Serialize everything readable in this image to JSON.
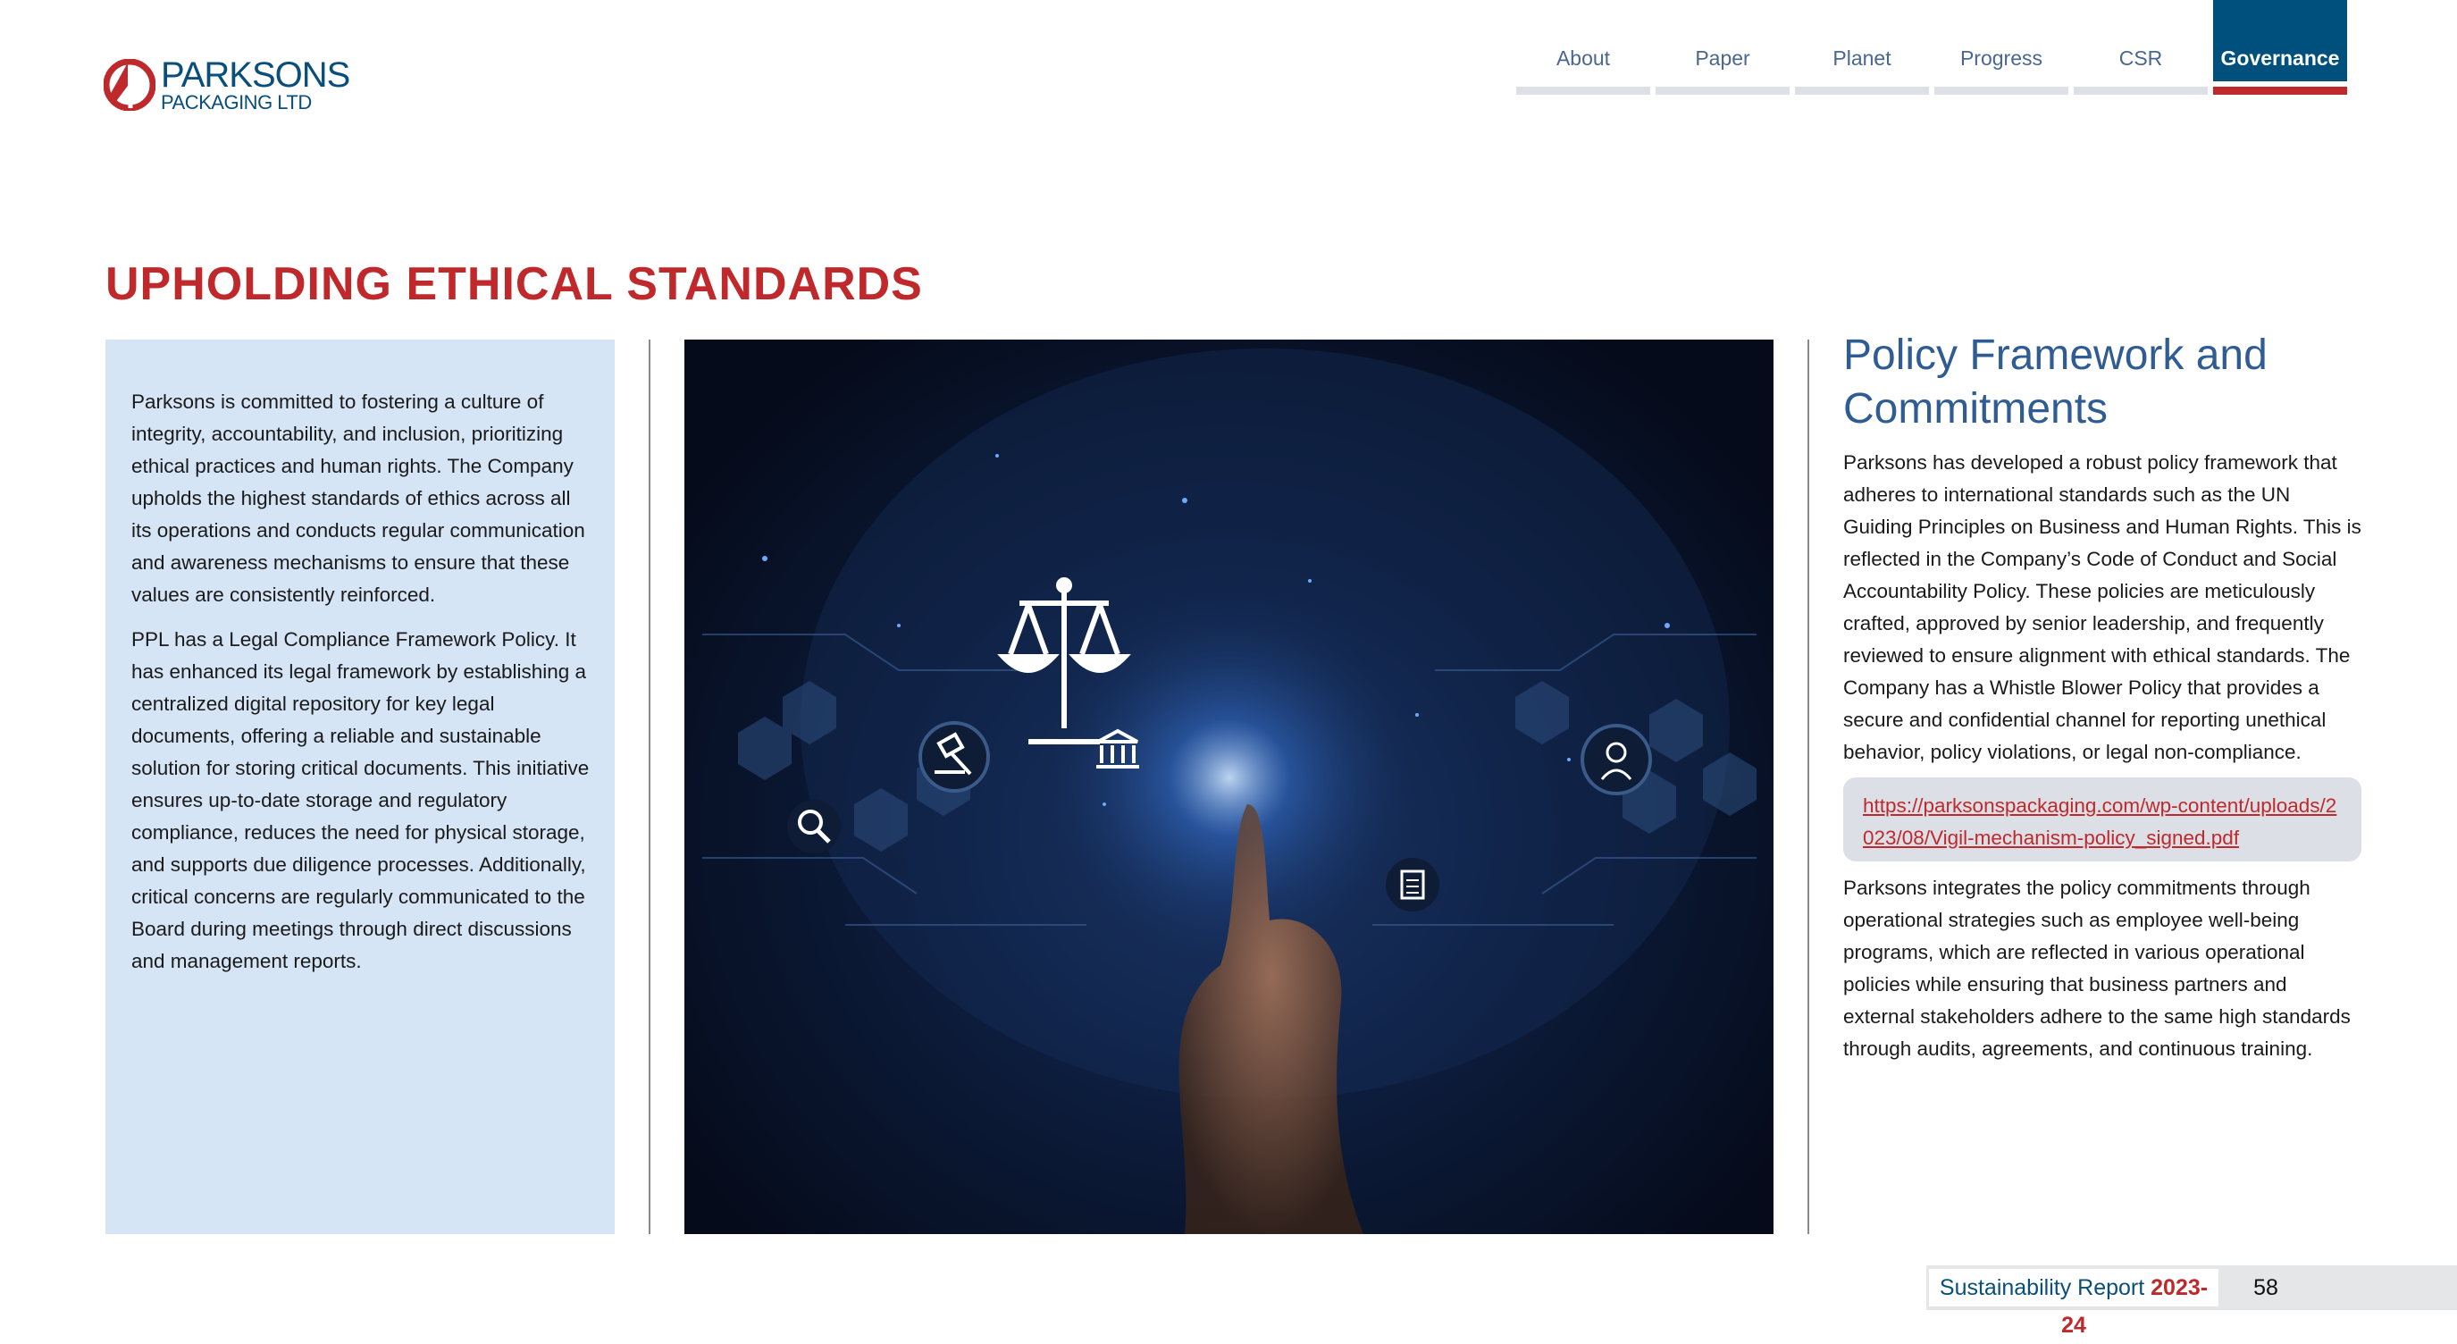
{
  "logo": {
    "line1": "PARKSONS",
    "line2": "PACKAGING LTD",
    "colors": {
      "red": "#c0292b",
      "blue": "#0a4e7c"
    }
  },
  "nav": {
    "tabs": [
      {
        "label": "About"
      },
      {
        "label": "Paper"
      },
      {
        "label": "Planet"
      },
      {
        "label": "Progress"
      },
      {
        "label": "CSR"
      },
      {
        "label": "Governance",
        "active": true
      }
    ]
  },
  "page_title": "UPHOLDING ETHICAL STANDARDS",
  "left": {
    "paragraphs": [
      "Parksons is committed to fostering a culture of integrity, accountability, and inclusion, prioritizing ethical practices and human rights. The Company upholds the highest standards of ethics across all its operations and conducts regular communication and awareness mechanisms to ensure that these values are consistently reinforced.",
      "PPL has a Legal Compliance Framework Policy. It has enhanced its legal framework by establishing a centralized digital repository for key legal documents, offering a reliable and sustainable solution for storing critical documents. This initiative ensures up-to-date storage and regulatory compliance, reduces the need for physical storage, and supports due diligence processes. Additionally, critical concerns are regularly communicated to the Board during meetings through direct discussions and management reports."
    ]
  },
  "image": {
    "icons": [
      "scales-of-justice-icon",
      "gavel-icon",
      "bank-icon",
      "magnifier-icon",
      "document-icon",
      "judge-icon"
    ]
  },
  "right": {
    "heading": "Policy Framework and Commitments",
    "para1": "Parksons has developed a robust policy framework that adheres to international standards such as the UN Guiding Principles on Business and Human Rights. This is reflected in the Company’s Code of Conduct and Social Accountability Policy. These policies are meticulously crafted, approved by senior leadership, and frequently reviewed to ensure alignment with ethical standards. The Company has a Whistle Blower Policy that provides a secure and confidential channel for reporting unethical behavior, policy violations, or legal non-compliance.",
    "link": "https://parksonspackaging.com/wp-content/uploads/2023/08/Vigil-mechanism-policy_signed.pdf",
    "para2": "Parksons integrates the policy commitments through operational strategies such as employee well-being programs, which are reflected in various operational policies while ensuring that business partners and external stakeholders adhere to the same high standards through audits, agreements, and continuous training."
  },
  "footer": {
    "report": "Sustainability Report",
    "year": "2023-24",
    "page": "58"
  }
}
